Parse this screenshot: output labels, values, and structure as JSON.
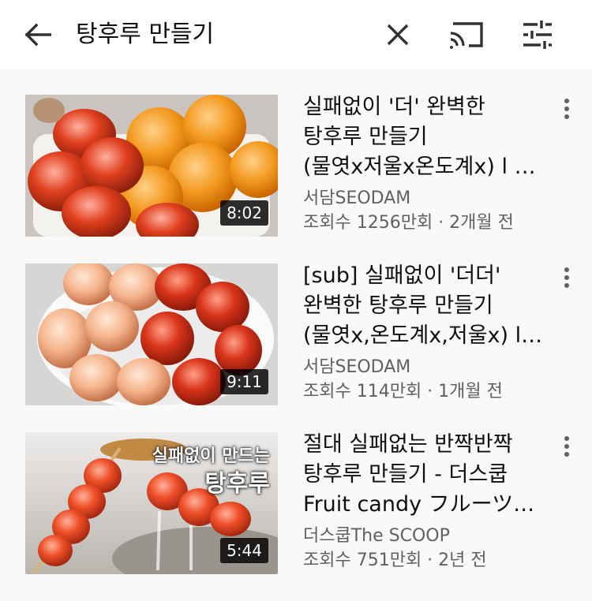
{
  "search": {
    "query": "탕후루 만들기"
  },
  "icons": {
    "back": "arrow-left-icon",
    "clear": "close-icon",
    "cast": "cast-icon",
    "filter": "tune-icon",
    "more": "more-vert-icon"
  },
  "results": [
    {
      "title": "실패없이 '더' 완벽한 탕후루 만들기 (물엿x저울x온도계x) l a perfect t…",
      "channel": "서담SEODAM",
      "meta": "조회수 1256만회 · 2개월 전",
      "duration": "8:02"
    },
    {
      "title": "[sub] 실패없이 '더더' 완벽한 탕후루 만들기 (물엿x,온도계x,저울x) l a…",
      "channel": "서담SEODAM",
      "meta": "조회수 114만회 · 1개월 전",
      "duration": "9:11"
    },
    {
      "title": "절대 실패없는 반짝반짝 탕후루 만들기 - 더스쿱 Fruit candy フルーツ…",
      "channel": "더스쿱The SCOOP",
      "meta": "조회수 751만회 · 2년 전",
      "duration": "5:44",
      "thumb_caption_1": "실패없이 만드는",
      "thumb_caption_2": "탕후루"
    }
  ],
  "colors": {
    "background": "#ffffff",
    "list_background": "#f9f9f9",
    "secondary_text": "#606060"
  }
}
